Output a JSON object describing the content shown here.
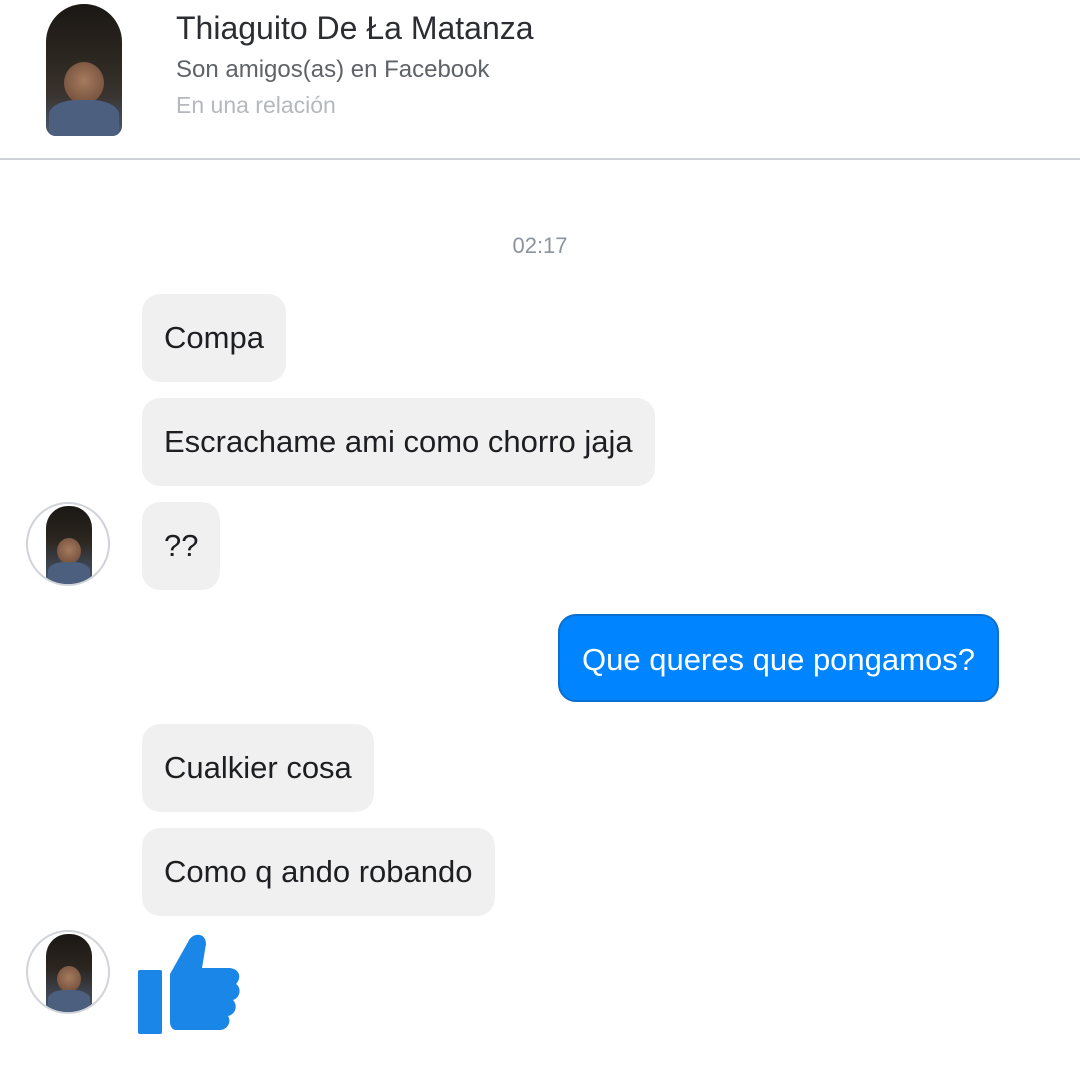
{
  "header": {
    "contact_name": "Thiaguito De Ła Matanza",
    "friend_status": "Son amigos(as) en Facebook",
    "relationship": "En una relación"
  },
  "conversation": {
    "timestamp": "02:17",
    "messages": [
      {
        "direction": "incoming",
        "text": "Compa"
      },
      {
        "direction": "incoming",
        "text": "Escrachame ami como chorro jaja"
      },
      {
        "direction": "incoming",
        "text": "??"
      },
      {
        "direction": "outgoing",
        "text": "Que queres que pongamos?"
      },
      {
        "direction": "incoming",
        "text": "Cualkier cosa"
      },
      {
        "direction": "incoming",
        "text": "Como q ando robando"
      },
      {
        "direction": "incoming",
        "type": "like",
        "icon": "thumbs-up-icon"
      }
    ]
  },
  "colors": {
    "outgoing_bubble": "#0084ff",
    "incoming_bubble": "#f1f0f0",
    "like_icon": "#1a87e8"
  }
}
